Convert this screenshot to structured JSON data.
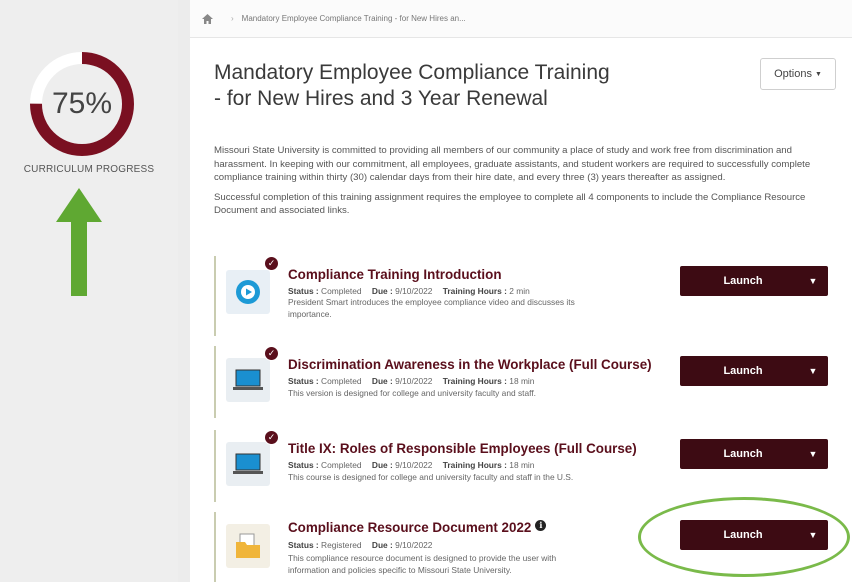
{
  "progress": {
    "percent_text": "75%",
    "fraction": 0.75,
    "label": "CURRICULUM PROGRESS",
    "ring_color": "#7a1021",
    "ring_track_color": "#ffffff",
    "arrow_color": "#5fa832"
  },
  "breadcrumb": {
    "home_icon": "home-icon",
    "current": "Mandatory Employee Compliance Training - for New Hires an..."
  },
  "header": {
    "title_line1": "Mandatory Employee Compliance Training",
    "title_line2": "- for New Hires and 3 Year Renewal",
    "options_label": "Options"
  },
  "description": {
    "paragraph1": "Missouri State University is committed to providing all members of our community a place of study and work free from discrimination and harassment. In keeping with our commitment, all employees, graduate assistants, and student workers are required to successfully complete compliance training within thirty (30) calendar days from their hire date, and every three (3) years thereafter as assigned.",
    "paragraph2": "Successful completion of this training assignment requires the employee to complete all 4 components to include the Compliance Resource Document and associated links."
  },
  "labels": {
    "status": "Status :",
    "due": "Due :",
    "hours": "Training Hours :"
  },
  "items": [
    {
      "title": "Compliance Training Introduction",
      "status": "Completed",
      "due": "9/10/2022",
      "hours": "2 min",
      "description": "President Smart introduces the employee compliance video and discusses its importance.",
      "launch_label": "Launch",
      "icon": "video-play-icon"
    },
    {
      "title": "Discrimination Awareness in the Workplace (Full Course)",
      "status": "Completed",
      "due": "9/10/2022",
      "hours": "18 min",
      "description": "This version is designed for college and university faculty and staff.",
      "launch_label": "Launch",
      "icon": "laptop-icon"
    },
    {
      "title": "Title IX: Roles of Responsible Employees (Full Course)",
      "status": "Completed",
      "due": "9/10/2022",
      "hours": "18 min",
      "description": "This course is designed for college and university faculty and staff in the U.S.",
      "launch_label": "Launch",
      "icon": "laptop-icon"
    },
    {
      "title": "Compliance Resource Document 2022",
      "status": "Registered",
      "due": "9/10/2022",
      "description": "This compliance resource document is designed to provide the user with information and policies specific to Missouri State University.",
      "launch_label": "Launch",
      "icon": "folder-document-icon"
    }
  ],
  "colors": {
    "launch_button": "#3d0b13",
    "title_accent": "#5a0f1c",
    "highlight_oval": "#7aba4a"
  }
}
